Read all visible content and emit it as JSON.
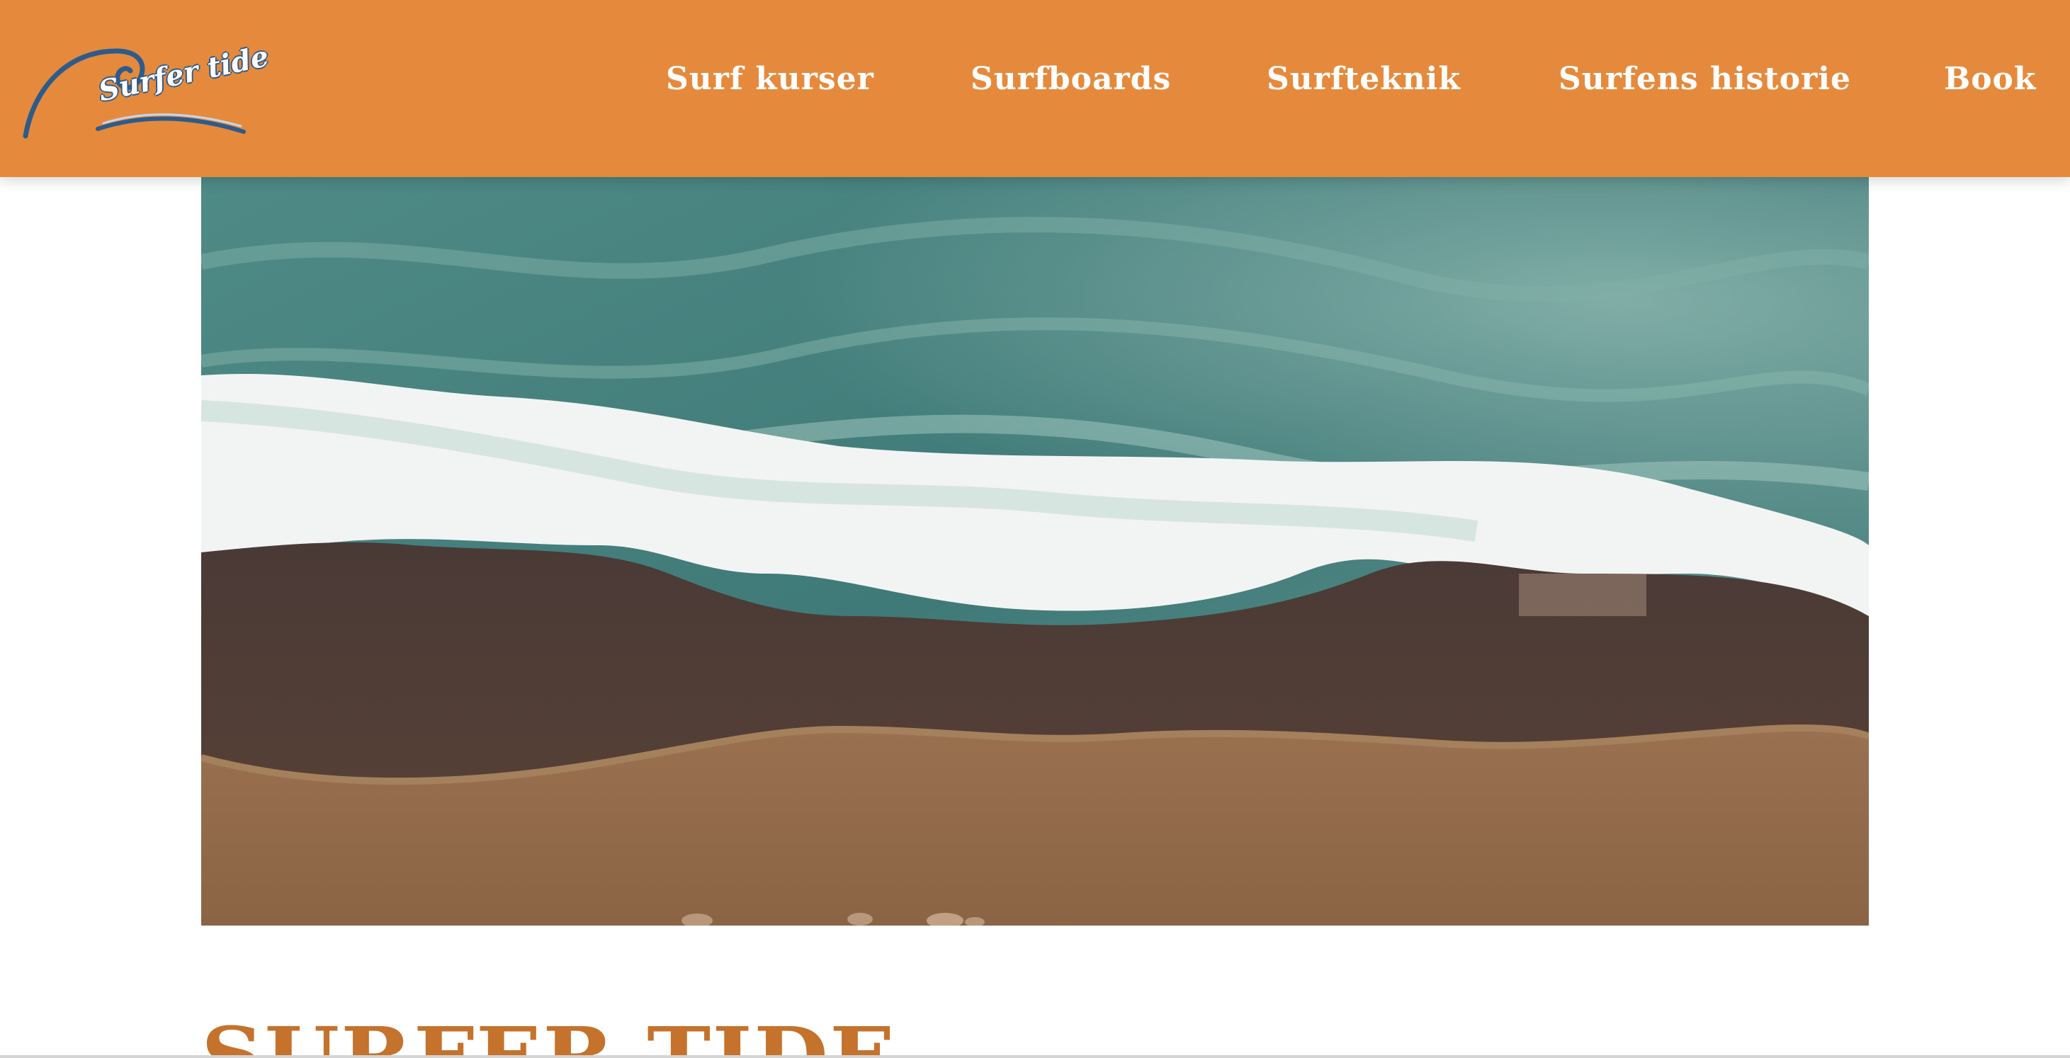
{
  "logo": {
    "text": "Surfer tide",
    "wave_color": "#2d5b8c"
  },
  "nav": {
    "items": [
      {
        "label": "Surf kurser"
      },
      {
        "label": "Surfboards"
      },
      {
        "label": "Surfteknik"
      },
      {
        "label": "Surfens historie"
      },
      {
        "label": "Book"
      }
    ]
  },
  "hero": {
    "image_alt": "Aerial view of waves breaking on a sandy beach"
  },
  "main": {
    "title": "SURFER TIDE"
  },
  "colors": {
    "header_bg": "#e58a3c",
    "title": "#c4722c",
    "nav_text": "#ffffff"
  }
}
